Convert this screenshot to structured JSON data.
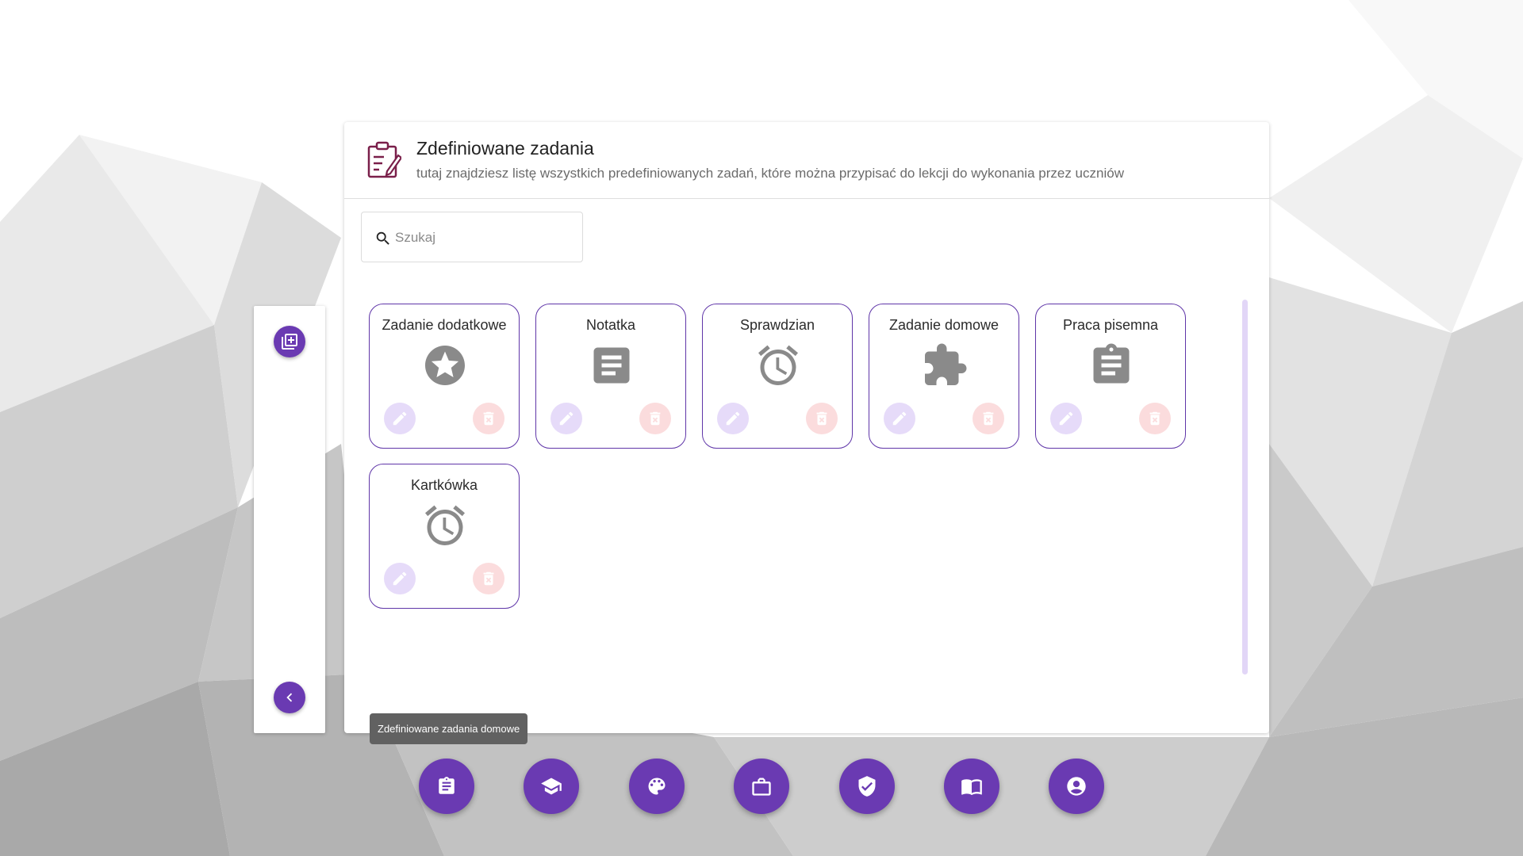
{
  "header": {
    "title": "Zdefiniowane zadania",
    "subtitle": "tutaj znajdziesz listę wszystkich predefiniowanych zadań, które można przypisać do lekcji do wykonania przez uczniów",
    "icon": "clipboard-edit-icon"
  },
  "search": {
    "placeholder": "Szukaj",
    "value": ""
  },
  "side_panel": {
    "add_icon": "library-add-icon",
    "collapse_icon": "chevron-left-icon"
  },
  "tasks": [
    {
      "title": "Zadanie dodatkowe",
      "icon": "star-circle-icon"
    },
    {
      "title": "Notatka",
      "icon": "article-icon"
    },
    {
      "title": "Sprawdzian",
      "icon": "alarm-clock-icon"
    },
    {
      "title": "Zadanie domowe",
      "icon": "puzzle-icon"
    },
    {
      "title": "Praca pisemna",
      "icon": "assignment-icon"
    },
    {
      "title": "Kartkówka",
      "icon": "alarm-clock-icon"
    }
  ],
  "tooltip": {
    "text": "Zdefiniowane zadania domowe"
  },
  "bottom_nav": [
    {
      "icon": "assignment-icon"
    },
    {
      "icon": "graduation-cap-icon"
    },
    {
      "icon": "palette-icon"
    },
    {
      "icon": "briefcase-icon"
    },
    {
      "icon": "verified-check-icon"
    },
    {
      "icon": "open-book-icon"
    },
    {
      "icon": "account-circle-icon"
    }
  ],
  "colors": {
    "accent": "#6a3ab2",
    "card_border": "#5f35a8",
    "edit_bg": "#e6dbf9",
    "delete_bg": "#fbdcdd",
    "icon_gray": "#8a8a8a"
  }
}
